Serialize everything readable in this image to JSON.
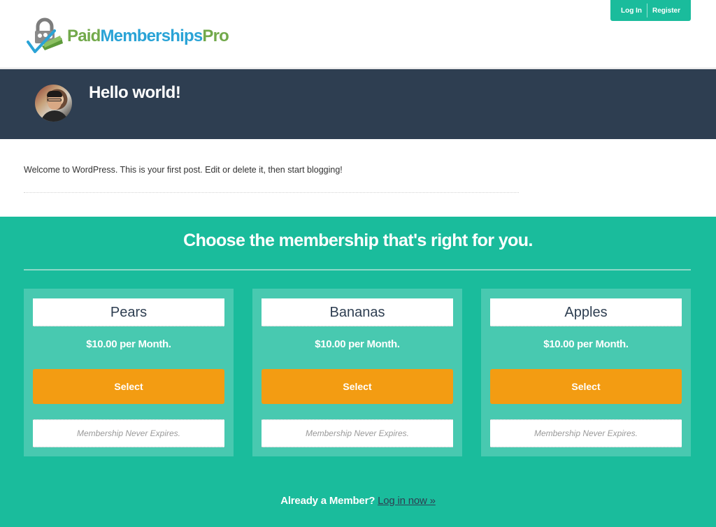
{
  "header": {
    "logo": {
      "icon": "lock-members-check-icon",
      "text_part1": "Paid",
      "text_part2": "Memberships",
      "text_part3": "Pro",
      "colors": {
        "green": "#72a94b",
        "blue": "#2aa3d6"
      }
    },
    "auth": {
      "login_label": "Log In",
      "register_label": "Register",
      "background": "#1abc9c"
    }
  },
  "post": {
    "title": "Hello world!",
    "avatar": "author-avatar",
    "content": "Welcome to WordPress. This is your first post. Edit or delete it, then start blogging!",
    "banner_color": "#2e3e51"
  },
  "levels": {
    "title": "Choose the membership that's right for you.",
    "background": "#1abc9c",
    "card_background": "#48c9b0",
    "button_color": "#f39c12",
    "cards": [
      {
        "name": "Pears",
        "price": "$10.00 per Month.",
        "button_label": "Select",
        "expiration": "Membership Never Expires."
      },
      {
        "name": "Bananas",
        "price": "$10.00 per Month.",
        "button_label": "Select",
        "expiration": "Membership Never Expires."
      },
      {
        "name": "Apples",
        "price": "$10.00 per Month.",
        "button_label": "Select",
        "expiration": "Membership Never Expires."
      }
    ],
    "footer": {
      "prompt": "Already a Member?",
      "link_label": "Log in now »"
    }
  }
}
